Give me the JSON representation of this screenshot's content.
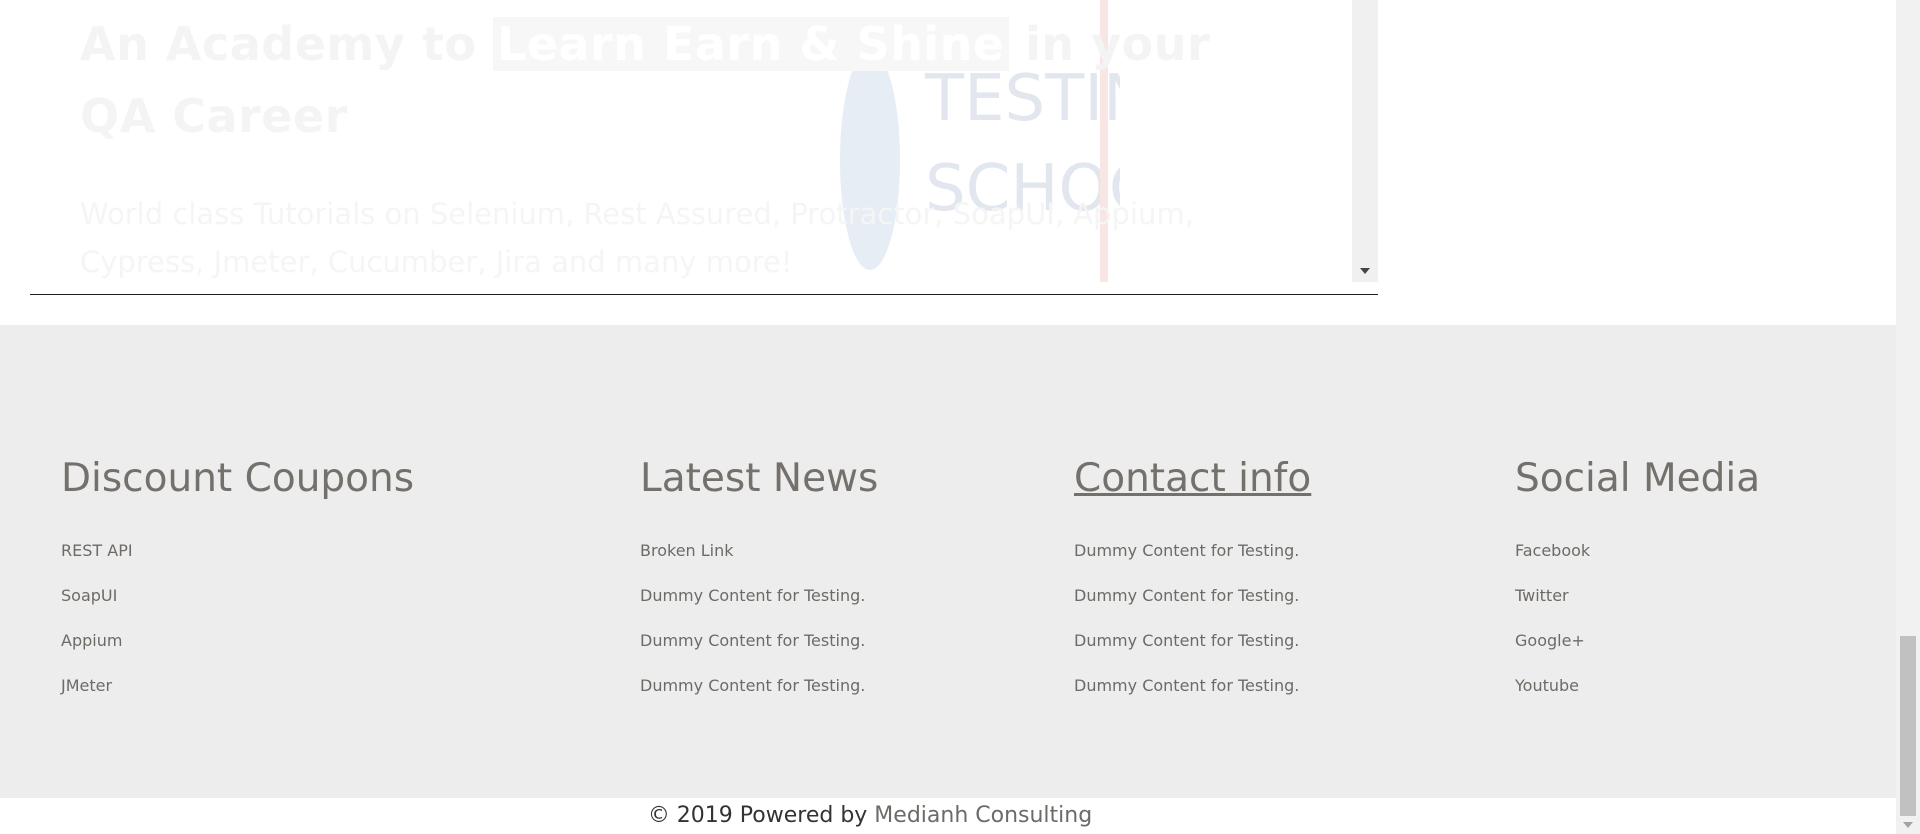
{
  "hero": {
    "title_part1": "An Academy to",
    "title_highlight": "Learn Earn & Shine",
    "title_part2": " in your QA Career",
    "subtitle": "World class Tutorials on Selenium, Rest Assured, Protractor, SoapUI, Appium, Cypress, Jmeter, Cucumber, Jira and many more!",
    "logo_text_line1": "TESTING",
    "logo_text_line2": "SCHOOL"
  },
  "footer": {
    "columns": [
      {
        "title": "Discount Coupons",
        "items": [
          "REST API",
          "SoapUI",
          "Appium",
          "JMeter"
        ]
      },
      {
        "title": "Latest News",
        "items": [
          "Broken Link",
          "Dummy Content for Testing.",
          "Dummy Content for Testing.",
          "Dummy Content for Testing."
        ]
      },
      {
        "title": "Contact info",
        "items": [
          "Dummy Content for Testing.",
          "Dummy Content for Testing.",
          "Dummy Content for Testing.",
          "Dummy Content for Testing."
        ]
      },
      {
        "title": "Social Media",
        "items": [
          "Facebook",
          "Twitter",
          "Google+",
          "Youtube"
        ]
      }
    ]
  },
  "copyright": {
    "prefix": "© 2019 Powered by",
    "brand": "Medianh Consulting"
  },
  "colors": {
    "footer_bg": "#ededed",
    "footer_text": "#6e6a66",
    "heading_text": "#74706b"
  }
}
